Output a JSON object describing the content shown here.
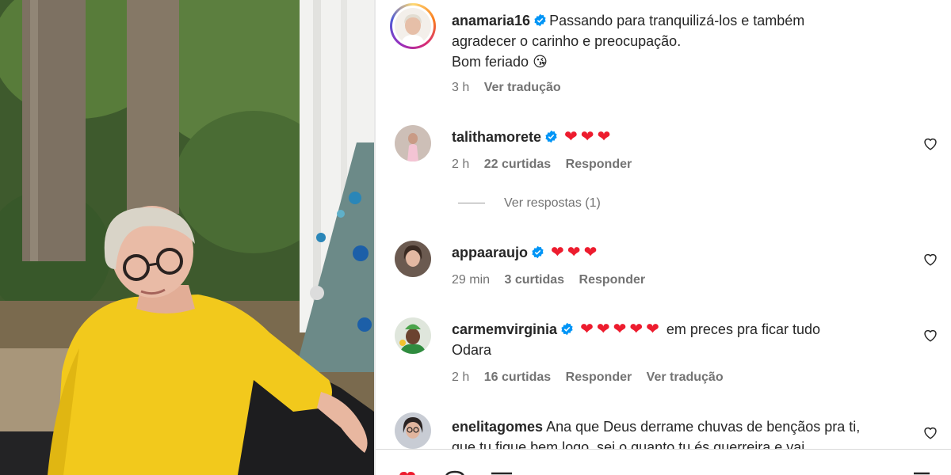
{
  "post": {
    "username": "anamaria16",
    "caption_line1": "Passando para tranquilizá-los e também",
    "caption_line2": "agradecer o carinho e preocupação.",
    "caption_line3": "Bom feriado",
    "caption_emoji": "😘",
    "time": "3 h",
    "translate": "Ver tradução"
  },
  "comments": [
    {
      "username": "talithamorete",
      "text": "",
      "hearts": "❤❤❤",
      "time": "2 h",
      "likes": "22 curtidas",
      "reply": "Responder",
      "replies_link": "Ver respostas (1)"
    },
    {
      "username": "appaaraujo",
      "text": "",
      "hearts": "❤❤❤",
      "time": "29 min",
      "likes": "3 curtidas",
      "reply": "Responder"
    },
    {
      "username": "carmemvirginia",
      "hearts": "❤❤❤❤❤",
      "text_line1": "em preces pra ficar tudo",
      "text_line2": "Odara",
      "time": "2 h",
      "likes": "16 curtidas",
      "reply": "Responder",
      "translate": "Ver tradução"
    },
    {
      "username": "enelitagomes",
      "text_line1": "Ana que Deus derrame chuvas de bençãos pra ti,",
      "text_line2": "que tu fique bem logo, sei o quanto tu és guerreira e vai"
    }
  ],
  "colors": {
    "heart_red": "#ed1c2e",
    "verified_blue": "#0095f6",
    "muted_text": "#737373",
    "primary_text": "#262626"
  },
  "icons": {
    "verified": "verified-badge-icon",
    "like": "heart-outline-icon"
  }
}
